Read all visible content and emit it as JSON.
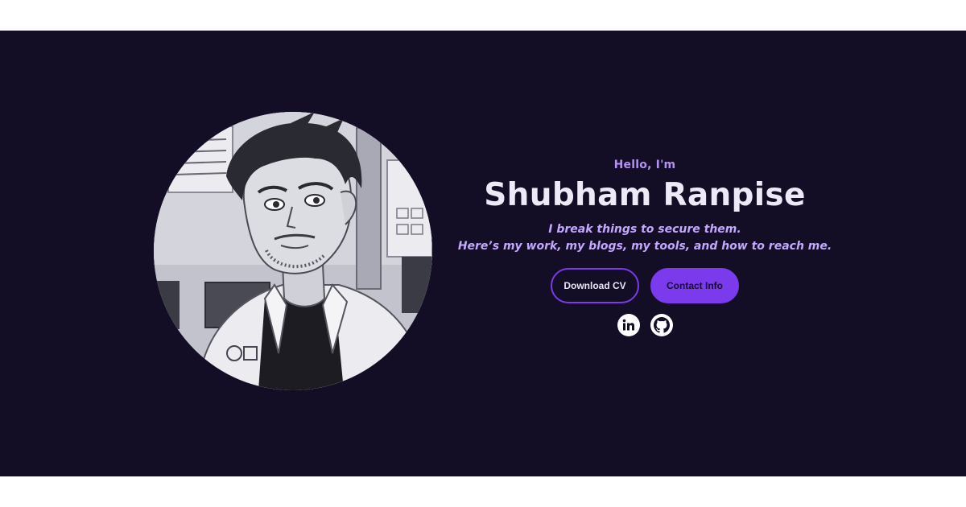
{
  "hero": {
    "greeting": "Hello, I'm",
    "name": "Shubham Ranpise",
    "tagline_line1": "I break things to secure them.",
    "tagline_line2": "Here’s my work, my blogs, my tools, and how to reach me.",
    "avatar_alt": "Profile illustration",
    "buttons": {
      "download_cv": "Download CV",
      "contact_info": "Contact Info"
    },
    "socials": [
      {
        "icon": "linkedin-icon"
      },
      {
        "icon": "github-icon"
      }
    ]
  },
  "colors": {
    "background": "#130d25",
    "accent": "#7c3aed",
    "greeting": "#b392f0",
    "name": "#ede9f7",
    "tagline": "#c4a7ff"
  }
}
